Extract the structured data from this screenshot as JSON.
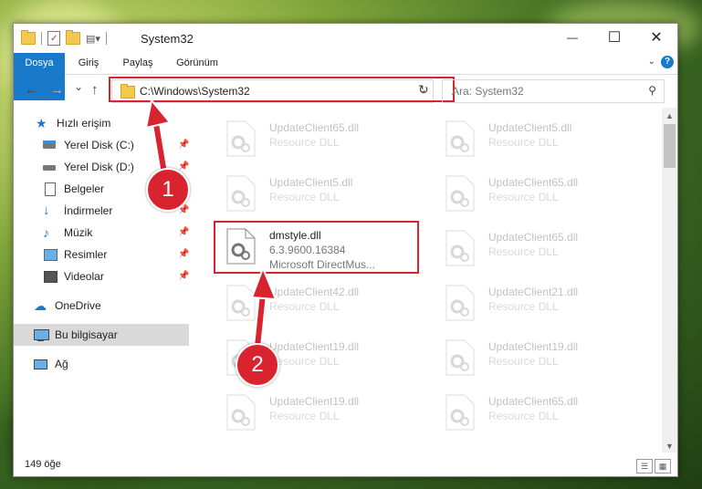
{
  "window": {
    "title": "System32",
    "minimize": "—",
    "maximize": "☐",
    "close": "✕"
  },
  "ribbon": {
    "tabs": [
      "Dosya",
      "Giriş",
      "Paylaş",
      "Görünüm"
    ],
    "help": "?"
  },
  "navigation": {
    "back": "←",
    "forward": "→",
    "recent": "⌄",
    "up": "↑",
    "address": "C:\\Windows\\System32",
    "refresh": "↻",
    "search_placeholder": "Ara: System32"
  },
  "sidebar": {
    "items": [
      {
        "label": "Hızlı erişim",
        "icon": "star-icon"
      },
      {
        "label": "Yerel Disk (C:)",
        "icon": "drive-icon",
        "pinned": true
      },
      {
        "label": "Yerel Disk (D:)",
        "icon": "drive-icon",
        "pinned": true
      },
      {
        "label": "Belgeler",
        "icon": "documents-icon",
        "pinned": true
      },
      {
        "label": "İndirmeler",
        "icon": "download-icon",
        "pinned": true
      },
      {
        "label": "Müzik",
        "icon": "music-icon",
        "pinned": true
      },
      {
        "label": "Resimler",
        "icon": "pictures-icon",
        "pinned": true
      },
      {
        "label": "Videolar",
        "icon": "videos-icon",
        "pinned": true
      },
      {
        "label": "OneDrive",
        "icon": "cloud-icon"
      },
      {
        "label": "Bu bilgisayar",
        "icon": "computer-icon",
        "selected": true
      },
      {
        "label": "Ağ",
        "icon": "network-icon"
      }
    ]
  },
  "files": [
    {
      "name": "UpdateClient65.dll",
      "type": "Resource DLL"
    },
    {
      "name": "UpdateClient5.dll",
      "type": "Resource DLL"
    },
    {
      "name": "UpdateClient5.dll",
      "type": "Resource DLL"
    },
    {
      "name": "UpdateClient65.dll",
      "type": "Resource DLL"
    },
    {
      "name": "dmstyle.dll",
      "version": "6.3.9600.16384",
      "type": "Microsoft DirectMus..."
    },
    {
      "name": "UpdateClient65.dll",
      "type": "Resource DLL"
    },
    {
      "name": "UpdateClient42.dll",
      "type": "Resource DLL"
    },
    {
      "name": "UpdateClient21.dll",
      "type": "Resource DLL"
    },
    {
      "name": "UpdateClient19.dll",
      "type": "Resource DLL"
    },
    {
      "name": "UpdateClient19.dll",
      "type": "Resource DLL"
    },
    {
      "name": "UpdateClient19.dll",
      "type": "Resource DLL"
    },
    {
      "name": "UpdateClient65.dll",
      "type": "Resource DLL"
    }
  ],
  "status": {
    "count": "149 öğe"
  },
  "annotations": {
    "step1": "1",
    "step2": "2",
    "color": "#d9232e"
  }
}
